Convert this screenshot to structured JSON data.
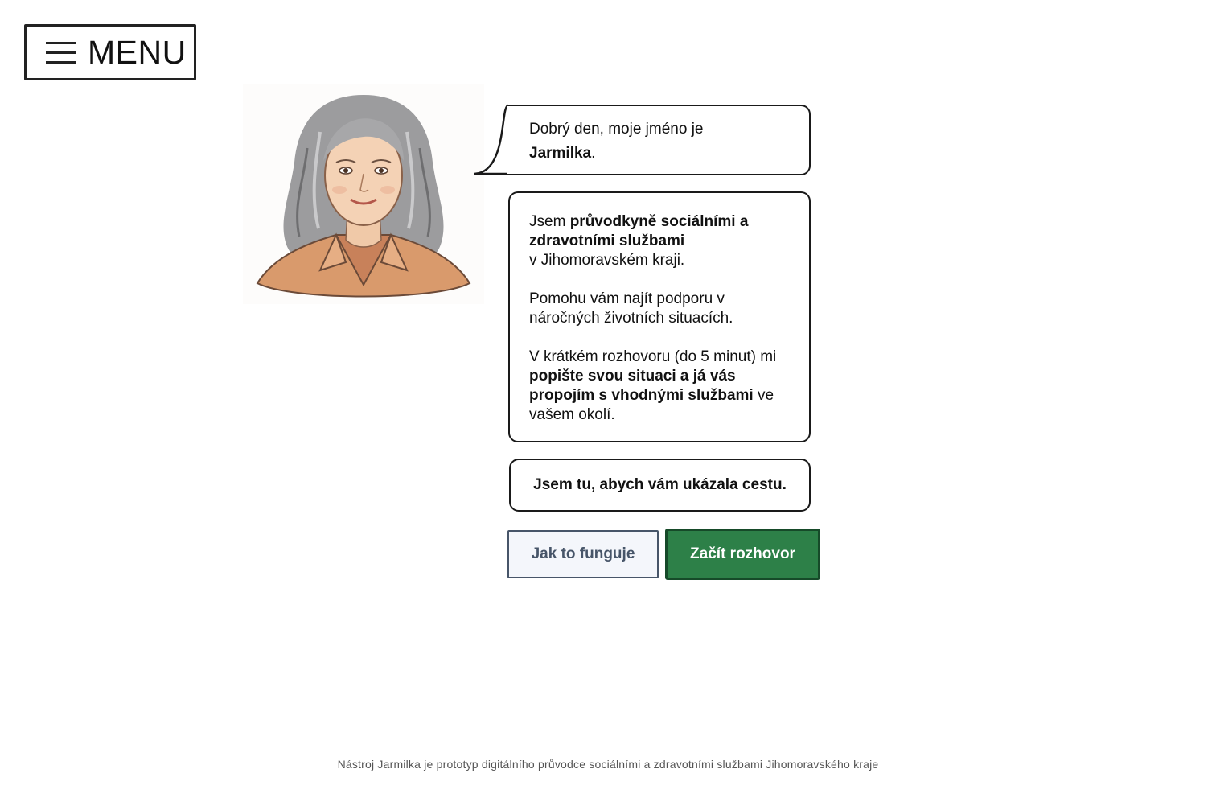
{
  "menu": {
    "label": "MENU",
    "icon": "hamburger-icon"
  },
  "avatar": {
    "name": "Jarmilka"
  },
  "greeting": {
    "prefix": "Dobrý den, moje jméno je ",
    "name": "Jarmilka",
    "suffix": "."
  },
  "intro": {
    "p1_pre": "Jsem ",
    "p1_bold": "průvodkyně sociálními a zdravotními službami",
    "p1_post": "v Jihomoravském kraji.",
    "p2": "Pomohu vám najít podporu v náročných životních situacích.",
    "p3_pre": "V krátkém rozhovoru (do 5 minut) mi ",
    "p3_bold": "popište svou situaci a já vás propojím s vhodnými službami",
    "p3_post": " ve vašem okolí."
  },
  "tagline": "Jsem tu, abych vám ukázala cestu.",
  "buttons": {
    "how_it_works": "Jak to funguje",
    "start": "Začít rozhovor"
  },
  "footer": "Nástroj Jarmilka je prototyp digitálního průvodce sociálními a zdravotními službami Jihomoravského kraje",
  "colors": {
    "primary": "#2d8048",
    "primary_border": "#164a29",
    "secondary_bg": "#f4f6fb",
    "secondary_text": "#475569",
    "outline": "#1a1a1a"
  }
}
